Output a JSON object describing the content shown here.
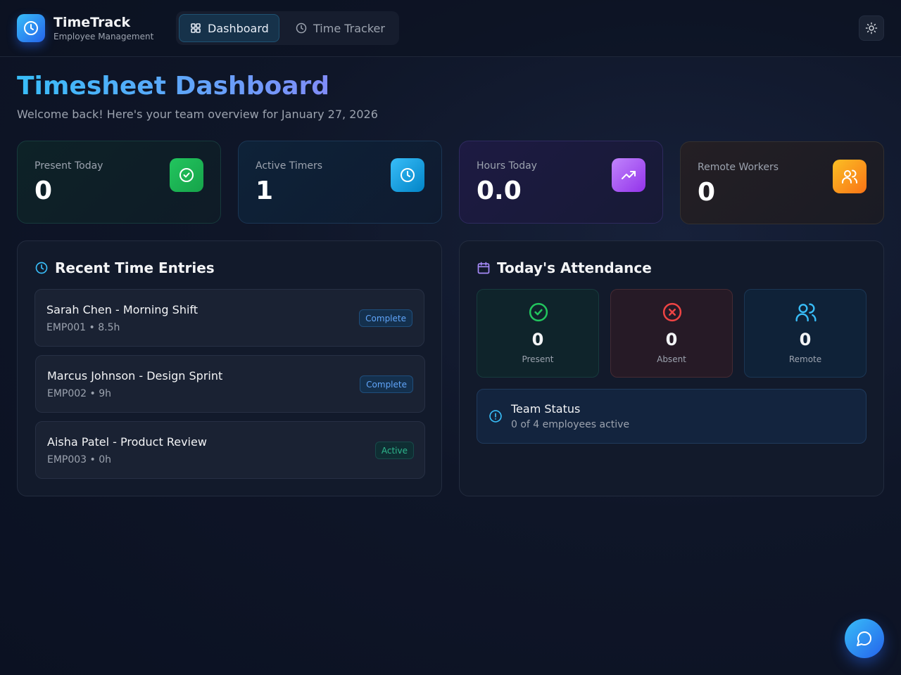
{
  "app": {
    "title": "TimeTrack",
    "subtitle": "Employee Management"
  },
  "nav": {
    "tabs": [
      {
        "label": "Dashboard",
        "icon": "grid-icon",
        "active": true
      },
      {
        "label": "Time Tracker",
        "icon": "clock-icon",
        "active": false
      }
    ],
    "theme_toggle_icon": "sun-icon"
  },
  "page": {
    "title": "Timesheet Dashboard",
    "subtitle": "Welcome back! Here's your team overview for January 27, 2026"
  },
  "stats": [
    {
      "label": "Present Today",
      "value": "0",
      "icon": "check-circle-icon",
      "color": "#22c55e"
    },
    {
      "label": "Active Timers",
      "value": "1",
      "icon": "clock-icon",
      "color": "#0ea5e9"
    },
    {
      "label": "Hours Today",
      "value": "0.0",
      "icon": "trending-up-icon",
      "color": "#a855f7"
    },
    {
      "label": "Remote Workers",
      "value": "0",
      "icon": "users-icon",
      "color": "#f59e0b"
    }
  ],
  "recent_entries": {
    "title": "Recent Time Entries",
    "items": [
      {
        "name": "Sarah Chen - Morning Shift",
        "meta": "EMP001 • 8.5h",
        "status": "Complete"
      },
      {
        "name": "Marcus Johnson - Design Sprint",
        "meta": "EMP002 • 9h",
        "status": "Complete"
      },
      {
        "name": "Aisha Patel - Product Review",
        "meta": "EMP003 • 0h",
        "status": "Active"
      }
    ]
  },
  "attendance": {
    "title": "Today's Attendance",
    "boxes": [
      {
        "value": "0",
        "label": "Present",
        "icon": "check-circle-icon",
        "color": "#22c55e"
      },
      {
        "value": "0",
        "label": "Absent",
        "icon": "x-circle-icon",
        "color": "#ef4444"
      },
      {
        "value": "0",
        "label": "Remote",
        "icon": "users-icon",
        "color": "#38bdf8"
      }
    ],
    "team_status": {
      "title": "Team Status",
      "text": "0 of 4 employees active"
    }
  },
  "chat_button_icon": "chat-bubble-icon"
}
